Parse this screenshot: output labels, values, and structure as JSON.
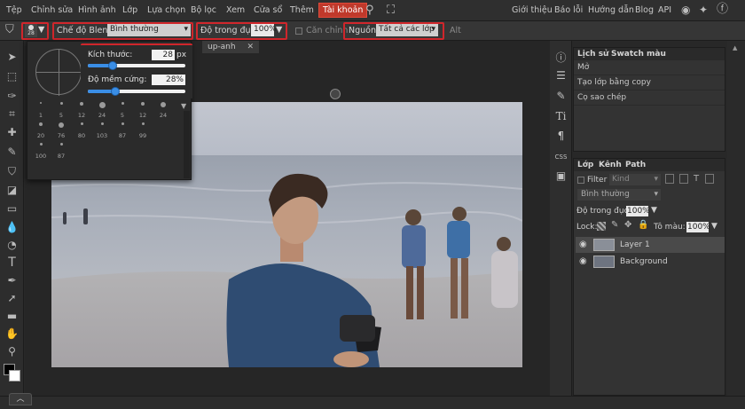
{
  "menubar": {
    "items": [
      "Tệp",
      "Chỉnh sửa",
      "Hình ảnh",
      "Lớp",
      "Lựa chọn",
      "Bộ lọc",
      "Xem",
      "Cửa sổ",
      "Thêm",
      "Tài khoản"
    ],
    "right": [
      "Giới thiệu",
      "Báo lỗi",
      "Hướng dẫn",
      "Blog",
      "API"
    ]
  },
  "options": {
    "brush_size_badge": "28",
    "blend_label": "Chế độ Blend:",
    "blend_value": "Bình thường",
    "opacity_label": "Độ trong đục:",
    "opacity_value": "100%",
    "align_label": "Căn chỉnh",
    "source_label": "Nguồn:",
    "source_value": "Tất cả các lớp",
    "alt_label": "Alt"
  },
  "document": {
    "tab_label": "up-anh",
    "close_glyph": "✕"
  },
  "brush_popup": {
    "size_label": "Kích thước:",
    "size_value": "28",
    "size_unit": "px",
    "size_fraction": 0.25,
    "hardness_label": "Độ mềm cứng:",
    "hardness_value": "28%",
    "hardness_fraction": 0.28,
    "presets": [
      {
        "n": "1",
        "d": 2
      },
      {
        "n": "5",
        "d": 3
      },
      {
        "n": "12",
        "d": 4
      },
      {
        "n": "24",
        "d": 7
      },
      {
        "n": "5",
        "d": 3
      },
      {
        "n": "12",
        "d": 4
      },
      {
        "n": "24",
        "d": 6
      },
      {
        "n": "20",
        "d": 4
      },
      {
        "n": "76",
        "d": 6
      },
      {
        "n": "80",
        "d": 3
      },
      {
        "n": "103",
        "d": 3
      },
      {
        "n": "87",
        "d": 3
      },
      {
        "n": "99",
        "d": 3
      },
      {
        "n": "",
        "d": 0
      },
      {
        "n": "100",
        "d": 3
      },
      {
        "n": "87",
        "d": 3
      }
    ]
  },
  "history_panel": {
    "tabs": [
      "Lịch sử",
      "Swatch màu"
    ],
    "rows": [
      "Mở",
      "Tạo lớp bằng copy",
      "Cọ sao chép"
    ]
  },
  "layers_panel": {
    "tabs": [
      "Lớp",
      "Kênh",
      "Path"
    ],
    "filter_label": "Filter",
    "kind_value": "Kind",
    "blend_value": "Bình thường",
    "opacity_label": "Độ trong đục:",
    "opacity_value": "100%",
    "lock_label": "Lock:",
    "fill_label": "Tô màu:",
    "fill_value": "100%",
    "layers": [
      "Layer 1",
      "Background"
    ]
  },
  "colors": {
    "accent_red": "#d0262b",
    "slider_blue": "#3a8ee6"
  }
}
